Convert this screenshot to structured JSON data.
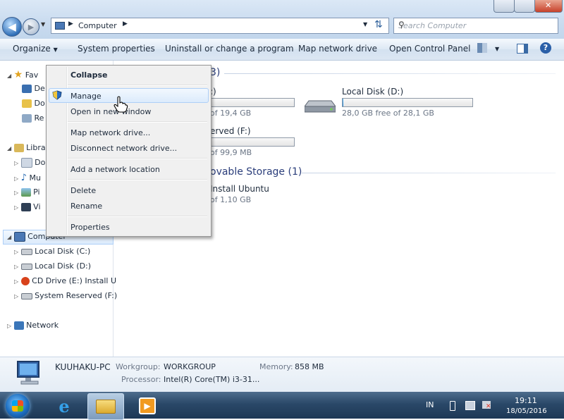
{
  "address": {
    "path_root": "Computer",
    "search_placeholder": "Search Computer"
  },
  "toolbar": {
    "organize": "Organize",
    "system_properties": "System properties",
    "uninstall": "Uninstall or change a program",
    "map_drive": "Map network drive",
    "control_panel": "Open Control Panel"
  },
  "nav": {
    "favorites_trunc": "Fav",
    "fav_items": [
      "De",
      "Do",
      "Re"
    ],
    "libraries_trunc": "Libra",
    "lib_items": [
      "Do",
      "Mu",
      "Pi",
      "Vi"
    ],
    "computer": "Computer",
    "drives": [
      "Local Disk (C:)",
      "Local Disk (D:)",
      "CD Drive (E:) Install U",
      "System Reserved (F:)"
    ],
    "network": "Network"
  },
  "main": {
    "hdd_count_trunc": "3)",
    "drive_c_name_trunc": ":)",
    "drive_c_free_trunc": "of 19,4 GB",
    "drive_d_name": "Local Disk (D:)",
    "drive_d_free": "28,0 GB free of 28,1 GB",
    "drive_f_name_trunc": "erved (F:)",
    "drive_f_free_trunc": "of 99,9 MB",
    "removable_header_trunc": "ovable Storage (1)",
    "cd_name_trunc": "Install Ubuntu",
    "cd_free_trunc": "of 1,10 GB",
    "drive_d_fill": 0.004
  },
  "context_menu": {
    "collapse": "Collapse",
    "manage": "Manage",
    "open_new_window": "Open in new window",
    "map_drive": "Map network drive...",
    "disconnect": "Disconnect network drive...",
    "add_location": "Add a network location",
    "delete": "Delete",
    "rename": "Rename",
    "properties": "Properties"
  },
  "details": {
    "pc_name": "KUUHAKU-PC",
    "workgroup_label": "Workgroup:",
    "workgroup_value": "WORKGROUP",
    "memory_label": "Memory:",
    "memory_value": "858 MB",
    "processor_label": "Processor:",
    "processor_value": "Intel(R) Core(TM) i3-31..."
  },
  "taskbar": {
    "lang": "IN",
    "time": "19:11",
    "date": "18/05/2016"
  },
  "icons": [
    "back-arrow-icon",
    "forward-arrow-icon",
    "computer-icon",
    "refresh-icon",
    "search-icon",
    "view-icon",
    "preview-pane-icon",
    "help-icon",
    "star-icon",
    "library-icon",
    "drive-icon",
    "cd-ubuntu-icon",
    "network-icon",
    "shield-icon",
    "hand-cursor-icon",
    "windows-start-icon",
    "ie-icon",
    "explorer-icon",
    "media-player-icon"
  ]
}
